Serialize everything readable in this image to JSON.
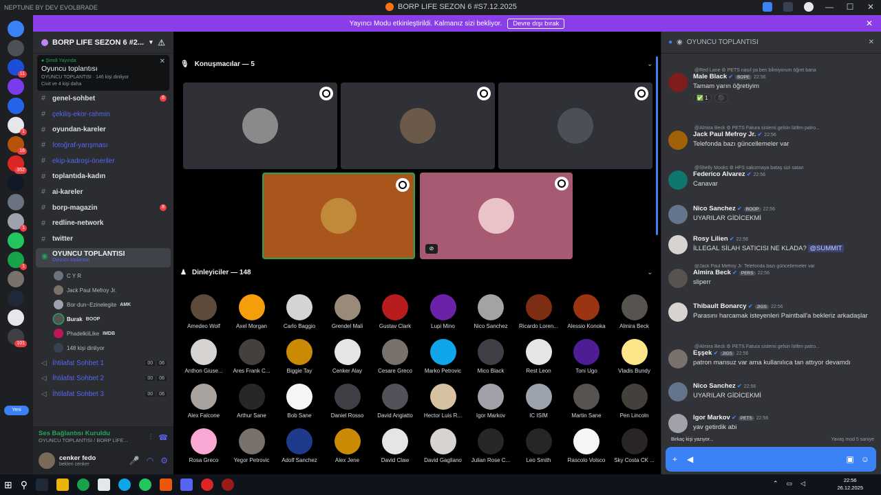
{
  "titlebar": {
    "brand": "NEPTUNE BY DEV EVOLBRADE",
    "title": "BORP LIFE SEZON 6 #S7.12.2025"
  },
  "banner": {
    "text": "Yayıncı Modu etkinleştirildi. Kalmanız sizi bekliyor.",
    "button": "Devre dışı bırak"
  },
  "servers": [
    {
      "color": "#3b82f6",
      "badge": ""
    },
    {
      "color": "#4e5058",
      "badge": ""
    },
    {
      "color": "#1d4ed8",
      "badge": "11"
    },
    {
      "color": "#7c3aed",
      "badge": ""
    },
    {
      "color": "#2563eb",
      "badge": ""
    },
    {
      "color": "#e5e7eb",
      "badge": "1"
    },
    {
      "color": "#b45309",
      "badge": "16"
    },
    {
      "color": "#dc2626",
      "badge": "352"
    },
    {
      "color": "#111827",
      "badge": ""
    },
    {
      "color": "#6b7280",
      "badge": ""
    },
    {
      "color": "#9ca3af",
      "badge": "1"
    },
    {
      "color": "#22c55e",
      "badge": ""
    },
    {
      "color": "#16a34a",
      "badge": "1"
    },
    {
      "color": "#78716c",
      "badge": ""
    },
    {
      "color": "#1f2937",
      "badge": ""
    },
    {
      "color": "#e5e7eb",
      "badge": ""
    },
    {
      "color": "#3f3f46",
      "badge": "101"
    }
  ],
  "server_add_label": "Yeni",
  "guild": {
    "name": "BORP LIFE SEZON 6 #2...",
    "event": {
      "live": "Şimdi Yayında",
      "title": "Oyuncu toplantısı",
      "meta": "OYUNCU TOPLANTISI · 146 kişi dinliyor",
      "meta2": "Civit ve 4 kişi daha"
    },
    "channels": [
      {
        "icon": "#",
        "label": "genel-sohbet",
        "link": false,
        "count": "8"
      },
      {
        "icon": "#",
        "label": "çekiliş-ekor-rahmin",
        "link": true,
        "count": ""
      },
      {
        "icon": "#",
        "label": "oyundan-kareler",
        "link": false,
        "count": ""
      },
      {
        "icon": "#",
        "label": "fotoğraf-yarışması",
        "link": true,
        "count": ""
      },
      {
        "icon": "#",
        "label": "ekip-kadroşi-öneriler",
        "link": true,
        "count": ""
      },
      {
        "icon": "#",
        "label": "toplantıda-kadın",
        "link": false,
        "count": ""
      },
      {
        "icon": "#",
        "label": "ai-kareler",
        "link": false,
        "count": ""
      },
      {
        "icon": "#",
        "label": "borp-magazin",
        "link": false,
        "count": "8"
      },
      {
        "icon": "#",
        "label": "redline-network",
        "link": false,
        "count": ""
      },
      {
        "icon": "#",
        "label": "twitter",
        "link": false,
        "count": ""
      }
    ],
    "active_voice": {
      "label": "OYUNCU TOPLANTISI",
      "sub": "Oyuncu toplantısı"
    },
    "voice_users": [
      {
        "name": "C Y R",
        "color": "#6b7280",
        "bold": false,
        "speaking": false,
        "tag": ""
      },
      {
        "name": "Jack Paul Mefroy Jr.",
        "color": "#78716c",
        "bold": false,
        "speaking": false,
        "tag": ""
      },
      {
        "name": "Bor·dun~Ezinelegite",
        "color": "#9ca3af",
        "bold": false,
        "speaking": false,
        "tag": "AMK"
      },
      {
        "name": "Burak",
        "color": "#57534e",
        "bold": true,
        "speaking": true,
        "tag": "BOOP"
      },
      {
        "name": "PhadelkiiLike",
        "color": "#be185d",
        "bold": false,
        "speaking": false,
        "tag": "IMDB"
      },
      {
        "name": "148 kişi dinliyor",
        "color": "#374151",
        "bold": false,
        "speaking": false,
        "tag": ""
      }
    ],
    "extra_voice": [
      {
        "label": "İhtilafat Sohbet 1",
        "a": "00",
        "b": "06"
      },
      {
        "label": "İhtilafat Sohbet 2",
        "a": "00",
        "b": "06"
      },
      {
        "label": "İhtilafat Sohbet 3",
        "a": "00",
        "b": "06"
      }
    ],
    "voice_status": {
      "connected": "Ses Bağlantısı Kuruldu",
      "where": "OYUNCU TOPLANTISI / BORP LİFE..."
    },
    "user": {
      "name": "cenker fedo",
      "status": "beklen cenker"
    }
  },
  "stage": {
    "speakers_heading": "Konuşmacılar — 5",
    "audience_heading": "Dinleyiciler — 148",
    "speakers": [
      {
        "bg": "#2f3136",
        "av": "#8a8a8a",
        "border": ""
      },
      {
        "bg": "#2f3136",
        "av": "#6b5a4a",
        "border": ""
      },
      {
        "bg": "#2f3136",
        "av": "#4a4f58",
        "border": ""
      },
      {
        "bg": "#a8561c",
        "av": "#c08a3a",
        "border": "#23a55a"
      },
      {
        "bg": "#a85a72",
        "av": "#e9c3c8",
        "border": ""
      }
    ],
    "audience": [
      {
        "name": "Amedeo Wolf",
        "color": "#5c4a3a"
      },
      {
        "name": "Axel Morgan",
        "color": "#f59e0b"
      },
      {
        "name": "Carlo Baggio",
        "color": "#d4d4d4"
      },
      {
        "name": "Grendel Mali",
        "color": "#9a8a7a"
      },
      {
        "name": "Gustav Clark",
        "color": "#b91c1c"
      },
      {
        "name": "Lupi Mino",
        "color": "#6b21a8"
      },
      {
        "name": "Nico Sanchez",
        "color": "#a3a3a3"
      },
      {
        "name": "Ricardo Loren...",
        "color": "#7c2d12"
      },
      {
        "name": "Alessio Konoka",
        "color": "#9a3412"
      },
      {
        "name": "Almira Beck",
        "color": "#57534e"
      },
      {
        "name": "Anthon Giuse...",
        "color": "#d6d3d1"
      },
      {
        "name": "Ares Frank C...",
        "color": "#44403c"
      },
      {
        "name": "Biggie Tay",
        "color": "#ca8a04"
      },
      {
        "name": "Cenker Alay",
        "color": "#e7e5e4"
      },
      {
        "name": "Cesare Greco",
        "color": "#78716c"
      },
      {
        "name": "Marko Petrovic",
        "color": "#0ea5e9"
      },
      {
        "name": "Mico Black",
        "color": "#3f3f46"
      },
      {
        "name": "Rest Leon",
        "color": "#e5e5e5"
      },
      {
        "name": "Toni Ugo",
        "color": "#4c1d95"
      },
      {
        "name": "Vladis Bundy",
        "color": "#fde68a"
      },
      {
        "name": "Alex Falcone",
        "color": "#a8a29e"
      },
      {
        "name": "Arthur Sane",
        "color": "#27272a"
      },
      {
        "name": "Bob Sane",
        "color": "#f5f5f5"
      },
      {
        "name": "Daniel Rosso",
        "color": "#3f3f46"
      },
      {
        "name": "David Angiatto",
        "color": "#52525b"
      },
      {
        "name": "Hector Luis R...",
        "color": "#d6c2a0"
      },
      {
        "name": "Igor Markov",
        "color": "#a1a1aa"
      },
      {
        "name": "IC ISIM",
        "color": "#9ca3af"
      },
      {
        "name": "Martin Sane",
        "color": "#57534e"
      },
      {
        "name": "Pen Lincoln",
        "color": "#44403c"
      },
      {
        "name": "Rosa Greco",
        "color": "#f9a8d4"
      },
      {
        "name": "Yegor Petrovic",
        "color": "#78716c"
      },
      {
        "name": "Adolf Sanchez",
        "color": "#1e3a8a"
      },
      {
        "name": "Alex Jene",
        "color": "#ca8a04"
      },
      {
        "name": "David Claw",
        "color": "#e5e5e5"
      },
      {
        "name": "David Gagliano",
        "color": "#d6d3d1"
      },
      {
        "name": "Julian Rose C...",
        "color": "#27272a"
      },
      {
        "name": "Leo Smith",
        "color": "#262626"
      },
      {
        "name": "Rascolo Volsco",
        "color": "#f5f5f5"
      },
      {
        "name": "Sky Costa CK ...",
        "color": "#292524"
      }
    ]
  },
  "chat": {
    "title": "OYUNCU TOPLANTISI",
    "messages": [
      {
        "reply": "@Red Lane  ⚙ PETS  nasıl ya ben bilmiyorum öğret bana",
        "name": "Male Black",
        "tag": "BOPE",
        "time": "22:56",
        "text": "Tamam yarın öğretiyim",
        "av": "#7f1d1d",
        "mention": "",
        "reacts": [
          "✅ 1",
          "⚫"
        ]
      },
      {
        "reply": "@Almira Beck  ⚙ PETS  Fatura sistemi gelsin lütfen patro...",
        "name": "Jack Paul Mefroy Jr.",
        "tag": "",
        "time": "22:56",
        "text": "Telefonda bazı güncellemeler var",
        "av": "#a16207",
        "mention": "",
        "reacts": []
      },
      {
        "reply": "@Shelly Mooks  ⚙ HFS  sakızmaya bataş sizi satan",
        "name": "Federico Alvarez",
        "tag": "",
        "time": "22:56",
        "text": "Canavar",
        "av": "#0f766e",
        "mention": "",
        "reacts": []
      },
      {
        "reply": "",
        "name": "Nico Sanchez",
        "tag": "BOOP",
        "time": "22:56",
        "text": "UYARILAR GİDİCEKMİ",
        "av": "#64748b",
        "mention": "",
        "reacts": []
      },
      {
        "reply": "",
        "name": "Rosy Lilien",
        "tag": "",
        "time": "22:56",
        "text": "İLLEGAL SİLAH SATICISI NE KLADA?",
        "av": "#d6d3d1",
        "mention": "@SUMMIT",
        "reacts": []
      },
      {
        "reply": "@Jack Paul Mefroy Jr.  Telefonda bazı güncellemeler var",
        "name": "Almira Beck",
        "tag": "PERS",
        "time": "22:56",
        "text": "sliperr",
        "av": "#57534e",
        "mention": "",
        "reacts": []
      },
      {
        "reply": "",
        "name": "Thibault Bonarcy",
        "tag": "JIGS",
        "time": "22:56",
        "text": "Parasını harcamak isteyenleri Paintball'a bekleriz arkadaşlar",
        "av": "#d6d3d1",
        "mention": "",
        "reacts": []
      },
      {
        "reply": "@Almira Beck  ⚙ PETS  Fatura sistemi gelsin lütfen patro...",
        "name": "Eşşek",
        "tag": "JIGS",
        "time": "22:56",
        "text": "patron mansuz var ama kullanılıca tan attıyor devamdı",
        "av": "#78716c",
        "mention": "",
        "reacts": []
      },
      {
        "reply": "",
        "name": "Nico Sanchez",
        "tag": "",
        "time": "22:56",
        "text": "UYARILAR GİDİCEKMİ",
        "av": "#64748b",
        "mention": "",
        "reacts": []
      },
      {
        "reply": "",
        "name": "Igor Markov",
        "tag": "PETS",
        "time": "22:56",
        "text": "yav getirdik abi",
        "av": "#a1a1aa",
        "mention": "",
        "reacts": []
      }
    ],
    "typing": "Birkaç kişi yazıyor...",
    "typing_right": "Yavaş mod 5 saniye"
  },
  "clock": {
    "time": "22:56",
    "date": "26.12.2025"
  }
}
